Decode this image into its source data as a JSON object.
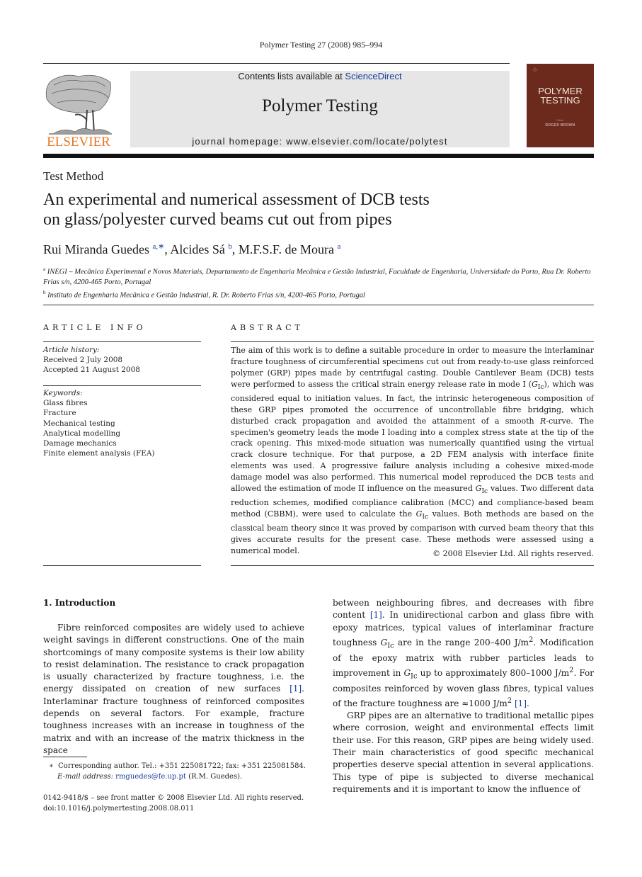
{
  "header": {
    "citation": "Polymer Testing 27 (2008) 985–994",
    "publisher_logo_text": "ELSEVIER",
    "contents_prefix": "Contents lists available at ",
    "contents_link": "ScienceDirect",
    "journal_title": "Polymer Testing",
    "homepage": "journal homepage: www.elsevier.com/locate/polytest",
    "cover": {
      "title_line1": "POLYMER",
      "title_line2": "TESTING",
      "editor_label": "Editor",
      "editor": "ROGER BROWN",
      "color": "#6b2a1c"
    },
    "brand_color": "#e87722",
    "link_color": "#1a3e9e"
  },
  "article": {
    "section_type": "Test Method",
    "title_line1": "An experimental and numerical assessment of DCB tests",
    "title_line2": "on glass/polyester curved beams cut out from pipes",
    "authors": [
      {
        "name": "Rui Miranda Guedes",
        "sup": "a,∗",
        "sep": ", "
      },
      {
        "name": "Alcides Sá",
        "sup": "b",
        "sep": ", "
      },
      {
        "name": "M.F.S.F. de Moura",
        "sup": "a",
        "sep": ""
      }
    ],
    "affiliations": [
      {
        "sup": "a",
        "text": "INEGI – Mecânica Experimental e Novos Materiais, Departamento de Engenharia Mecânica e Gestão Industrial, Faculdade de Engenharia, Universidade do Porto, Rua Dr. Roberto Frias s/n, 4200-465 Porto, Portugal"
      },
      {
        "sup": "b",
        "text": "Instituto de Engenharia Mecânica e Gestão Industrial, R. Dr. Roberto Frias s/n, 4200-465 Porto, Portugal"
      }
    ]
  },
  "article_info": {
    "heading": "ARTICLE INFO",
    "history_label": "Article history:",
    "received": "Received 2 July 2008",
    "accepted": "Accepted 21 August 2008",
    "keywords_label": "Keywords:",
    "keywords": [
      "Glass fibres",
      "Fracture",
      "Mechanical testing",
      "Analytical modelling",
      "Damage mechanics",
      "Finite element analysis (FEA)"
    ]
  },
  "abstract": {
    "heading": "ABSTRACT",
    "part1": "The aim of this work is to define a suitable procedure in order to measure the interlaminar fracture toughness of circumferential specimens cut out from ready-to-use glass reinforced polymer (GRP) pipes made by centrifugal casting. Double Cantilever Beam (DCB) tests were performed to assess the critical strain energy release rate in mode I (",
    "gic": "G",
    "gic_sub": "Ic",
    "part2": "), which was considered equal to initiation values. In fact, the intrinsic heterogeneous composition of these GRP pipes promoted the occurrence of uncontrollable fibre bridging, which disturbed crack propagation and avoided the attainment of a smooth ",
    "rcurve": "R",
    "part3": "-curve. The specimen's geometry leads the mode I loading into a complex stress state at the tip of the crack opening. This mixed-mode situation was numerically quantified using the virtual crack closure technique. For that purpose, a 2D FEM analysis with interface finite elements was used. A progressive failure analysis including a cohesive mixed-mode damage model was also performed. This numerical model reproduced the DCB tests and allowed the estimation of mode II influence on the measured ",
    "part4": " values. Two different data reduction schemes, modified compliance calibration (MCC) and compliance-based beam method (CBBM), were used to calculate the ",
    "part5": " values. Both methods are based on the classical beam theory since it was proved by comparison with curved beam theory that this gives accurate results for the present case. These methods were assessed using a numerical model.",
    "copyright": "© 2008 Elsevier Ltd. All rights reserved."
  },
  "introduction": {
    "heading": "1.  Introduction",
    "left_p1a": "Fibre reinforced composites are widely used to achieve weight savings in different constructions. One of the main shortcomings of many composite systems is their low ability to resist delamination. The resistance to crack propagation is usually characterized by fracture toughness, i.e. the energy dissipated on creation of new surfaces ",
    "ref1": "[1]",
    "left_p1b": ". Interlaminar fracture toughness of reinforced composites depends on several factors. For example, fracture toughness increases with an increase in toughness of the matrix and with an increase of the matrix thickness in the space",
    "right_p1a": "between neighbouring fibres, and decreases with fibre content ",
    "right_p1b": ". In unidirectional carbon and glass fibre with epoxy matrices, typical values of interlaminar fracture toughness ",
    "right_p1c": " are in the range 200–400 J/m",
    "right_p1d": ". Modification of the epoxy matrix with rubber particles leads to improvement in ",
    "right_p1e": " up to approximately 800–1000 J/m",
    "right_p1f": ". For composites reinforced by woven glass fibres, typical values of the fracture toughness are ≈1000 J/m",
    "right_p1g": ".",
    "sq": "2",
    "right_p2": "GRP pipes are an alternative to traditional metallic pipes where corrosion, weight and environmental effects limit their use. For this reason, GRP pipes are being widely used. Their main characteristics of good specific mechanical properties deserve special attention in several applications. This type of pipe is subjected to diverse mechanical requirements and it is important to know the influence of"
  },
  "footnote": {
    "marker": "∗",
    "text": "Corresponding author. Tel.: +351 225081722; fax: +351 225081584.",
    "email_label": "E-mail address: ",
    "email": "rmguedes@fe.up.pt",
    "email_suffix": " (R.M. Guedes)."
  },
  "footer": {
    "issn": "0142-9418/$ – see front matter © 2008 Elsevier Ltd. All rights reserved.",
    "doi": "doi:10.1016/j.polymertesting.2008.08.011"
  }
}
